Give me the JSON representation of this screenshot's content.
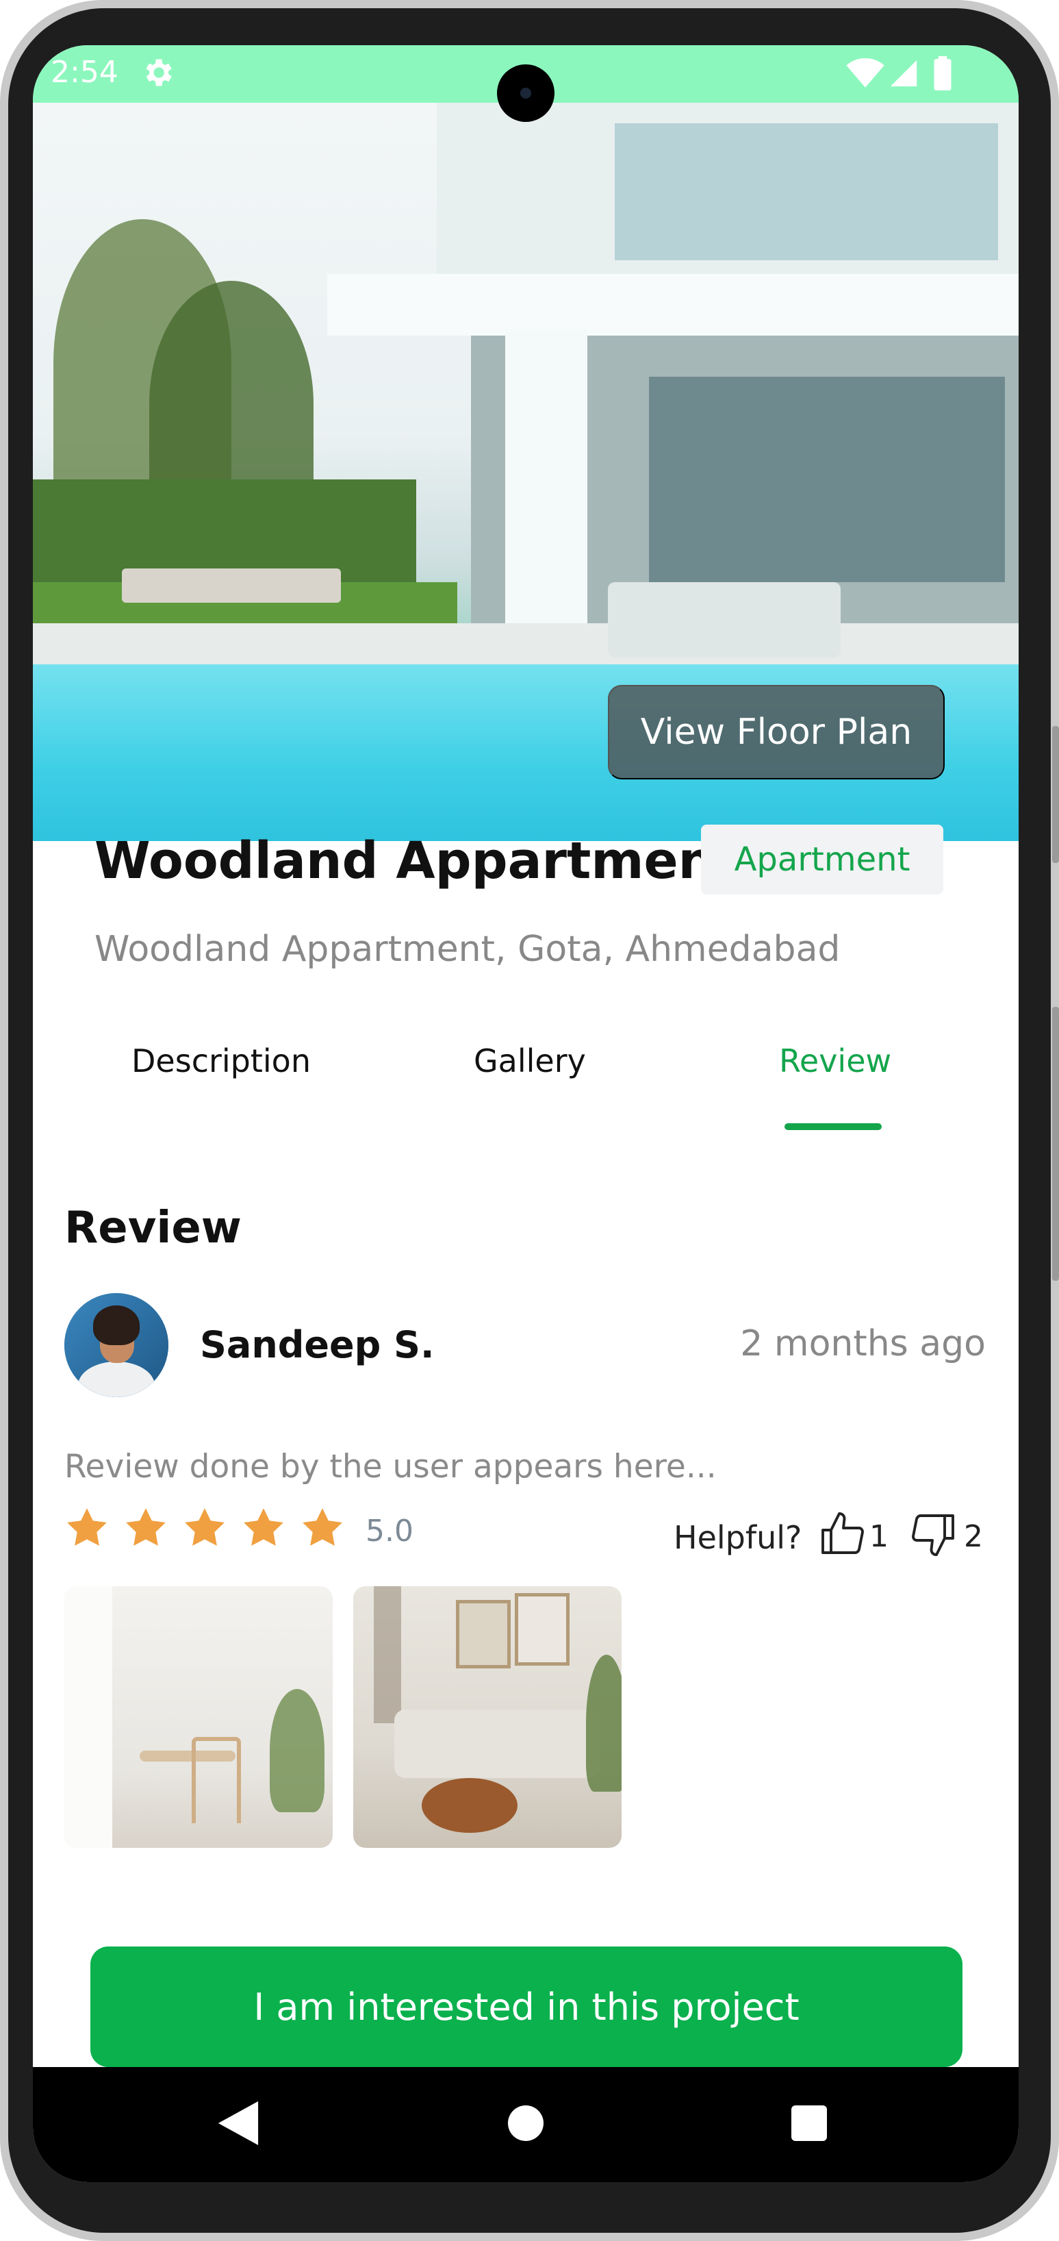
{
  "status_bar": {
    "time": "2:54",
    "settings_icon": "gear-icon",
    "wifi_icon": "wifi-icon",
    "signal_icon": "signal-icon",
    "battery_icon": "battery-icon",
    "color": "#8cf7bd"
  },
  "hero": {
    "image_description_icon": "property-photo",
    "floor_plan_button": "View Floor Plan"
  },
  "property": {
    "title": "Woodland Appartment",
    "type_badge": "Apartment",
    "address": "Woodland Appartment, Gota, Ahmedabad"
  },
  "tabs": [
    {
      "label": "Description",
      "active": false
    },
    {
      "label": "Gallery",
      "active": false
    },
    {
      "label": "Review",
      "active": true
    }
  ],
  "review_section": {
    "heading": "Review",
    "review": {
      "reviewer_name": "Sandeep S.",
      "time_ago": "2 months ago",
      "text": "Review done by the user appears here...",
      "rating": "5.0",
      "stars": 5,
      "helpful_label": "Helpful?",
      "likes": "1",
      "dislikes": "2",
      "photos": [
        "dining-room-photo",
        "living-room-photo"
      ]
    }
  },
  "cta": {
    "label": "I am interested in this project"
  },
  "colors": {
    "accent": "#14a54c",
    "cta": "#0ab14d",
    "star": "#f0a040"
  },
  "nav_bar": {
    "back_icon": "back-triangle-icon",
    "home_icon": "home-circle-icon",
    "recent_icon": "recents-square-icon"
  }
}
